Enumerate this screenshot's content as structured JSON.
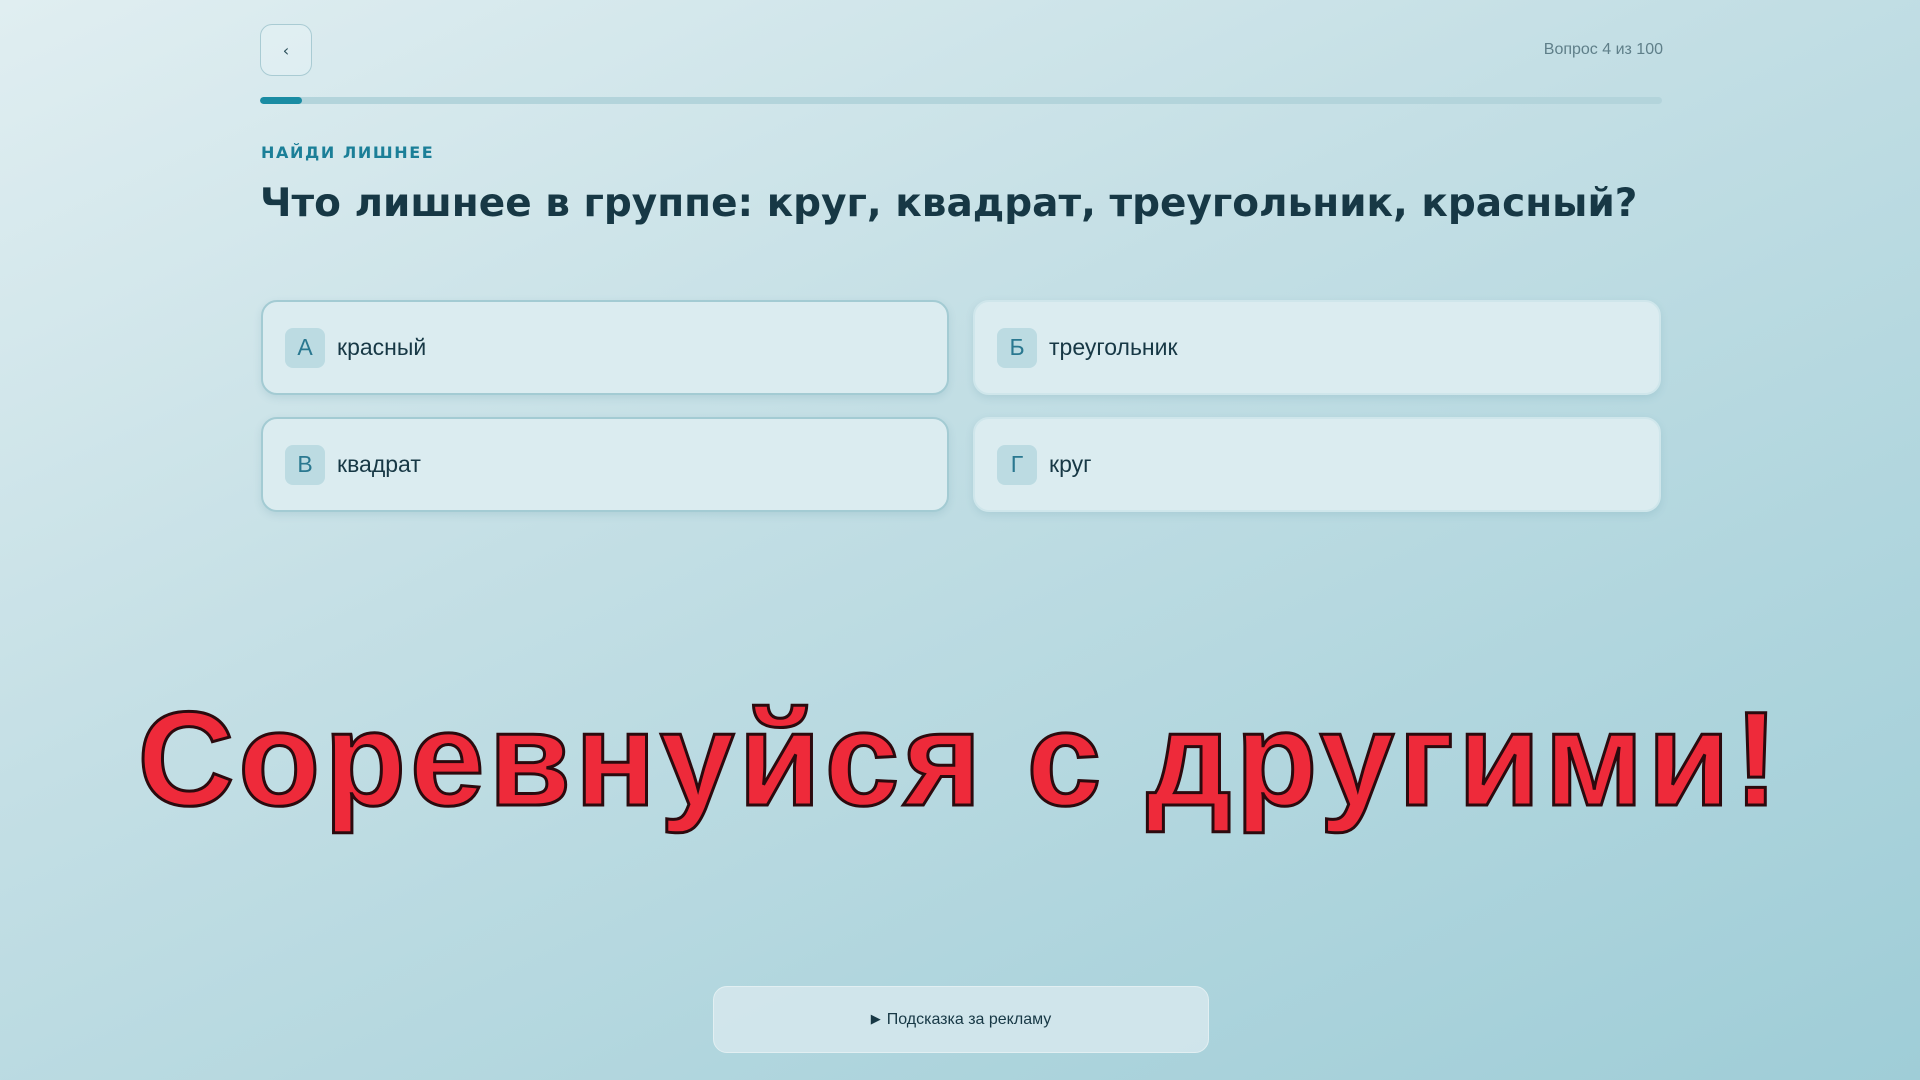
{
  "header": {
    "back_label": "‹",
    "counter": "Вопрос 4 из 100",
    "progress": 0.03
  },
  "question": {
    "category": "НАЙДИ ЛИШНЕЕ",
    "text": "Что лишнее в группе: круг, квадрат, треугольник, красный?"
  },
  "answers": [
    {
      "letter": "А",
      "text": "красный"
    },
    {
      "letter": "Б",
      "text": "треугольник"
    },
    {
      "letter": "В",
      "text": "квадрат"
    },
    {
      "letter": "Г",
      "text": "круг"
    }
  ],
  "banner": {
    "text": "Соревнуйся с другими!",
    "color": "#ee2a3a"
  },
  "hint": {
    "icon": "play-icon",
    "icon_glyph": "▶",
    "label": "Подсказка за рекламу"
  },
  "colors": {
    "accent": "#1a8ca3",
    "text": "#173845"
  }
}
